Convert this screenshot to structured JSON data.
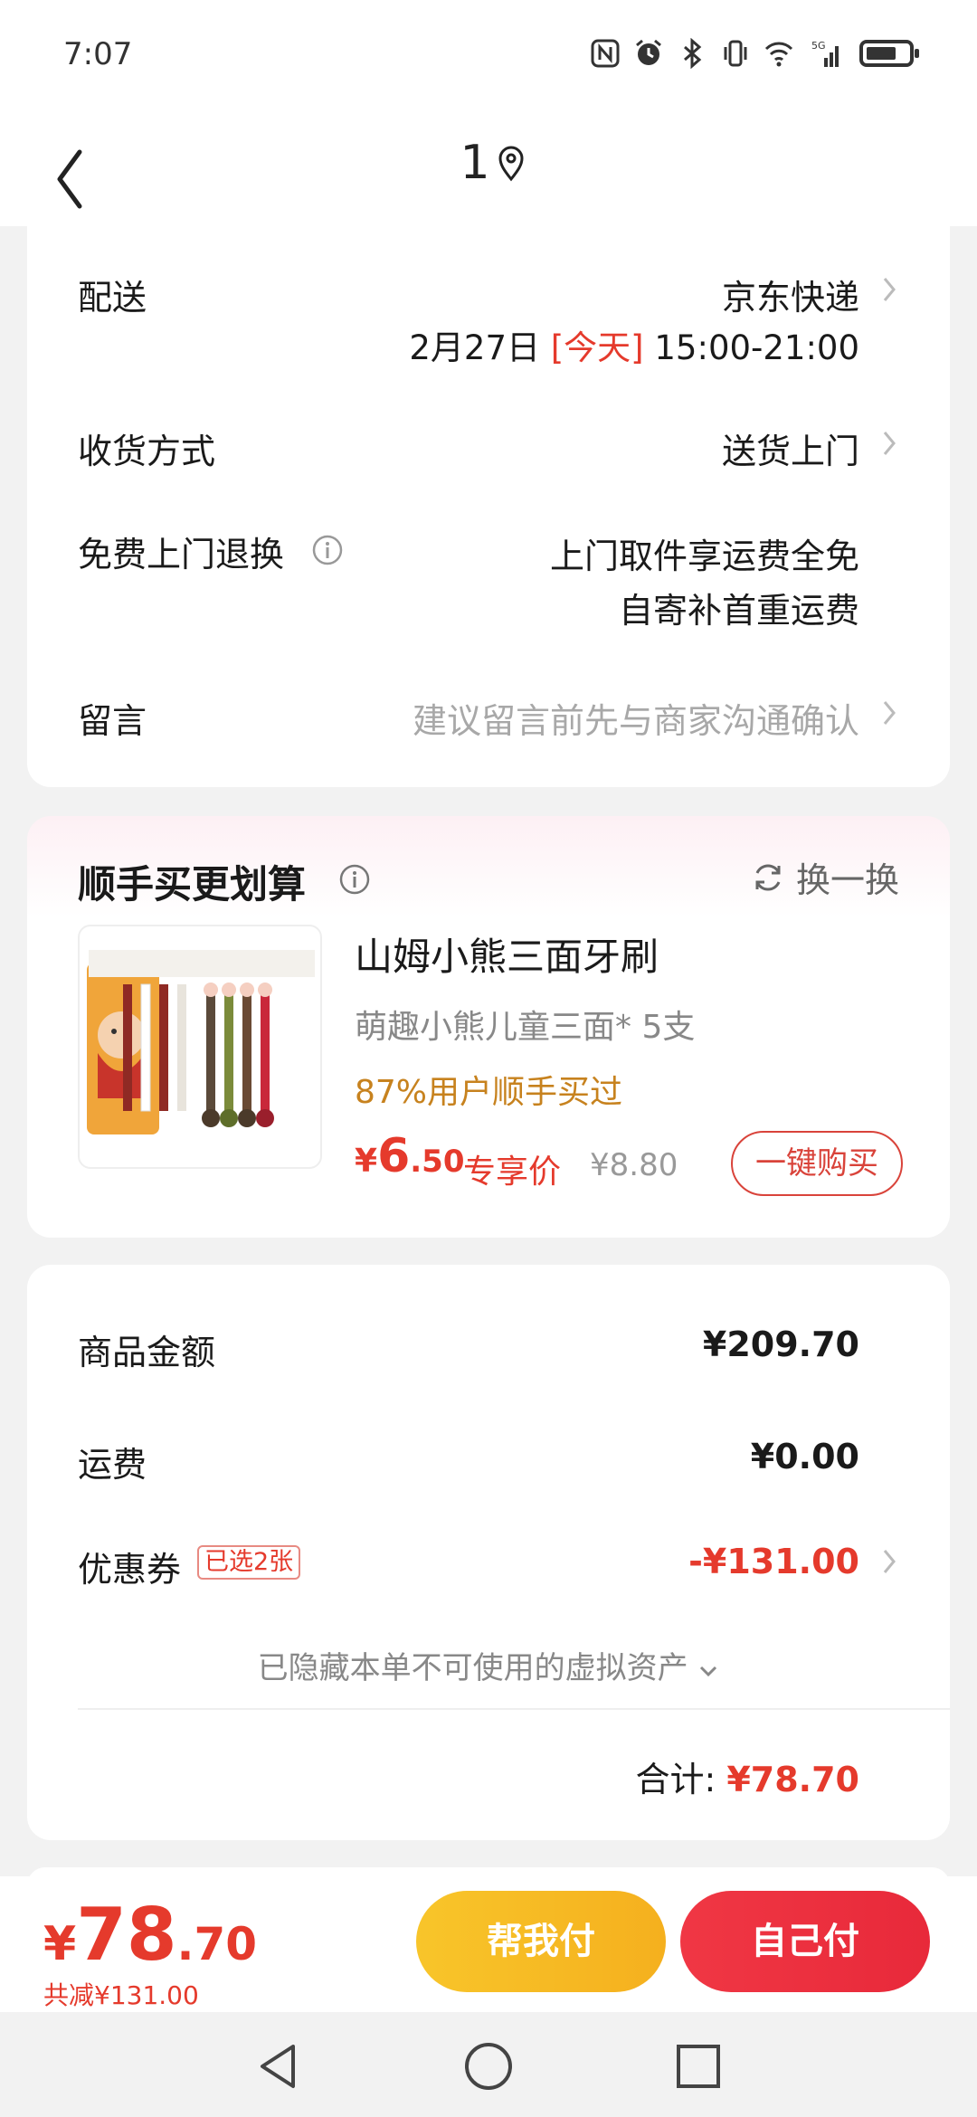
{
  "status_bar": {
    "time": "7:07",
    "icons": [
      "nfc-icon",
      "alarm-icon",
      "bluetooth-icon",
      "vibrate-icon",
      "wifi-icon",
      "signal-5g-icon",
      "battery-icon"
    ]
  },
  "header": {
    "title": "1",
    "back_icon": "chevron-left-icon",
    "location_icon": "location-pin-icon"
  },
  "delivery": {
    "label": "配送",
    "carrier": "京东快递",
    "date": "2月27日",
    "today_tag": "[今天]",
    "time_window": "15:00-21:00"
  },
  "receive_method": {
    "label": "收货方式",
    "value": "送货上门"
  },
  "free_return": {
    "label": "免费上门退换",
    "line1": "上门取件享运费全免",
    "line2": "自寄补首重运费"
  },
  "message": {
    "label": "留言",
    "placeholder": "建议留言前先与商家沟通确认"
  },
  "recommendation": {
    "title": "顺手买更划算",
    "swap_label": "换一换",
    "product": {
      "name": "山姆小熊三面牙刷",
      "desc": "萌趣小熊儿童三面* 5支",
      "social": "87%用户顺手买过",
      "price_currency": "¥",
      "price_int": "6",
      "price_dec": ".50",
      "price_tag": "专享价",
      "original_price": "¥8.80",
      "buy_label": "一键购买"
    }
  },
  "summary": {
    "goods_label": "商品金额",
    "goods_value": "¥209.70",
    "shipping_label": "运费",
    "shipping_value": "¥0.00",
    "coupon_label": "优惠券",
    "coupon_badge": "已选2张",
    "coupon_value": "-¥131.00",
    "hidden_note": "已隐藏本单不可使用的虚拟资产",
    "total_label": "合计:",
    "total_value": "¥78.70"
  },
  "bottom_bar": {
    "currency": "¥",
    "total_int": "78",
    "total_dec": ".70",
    "saved": "共减¥131.00",
    "help_pay": "帮我付",
    "self_pay": "自己付"
  },
  "colors": {
    "accent_red": "#e53a2c",
    "yellow": "#f8c52a",
    "social_orange": "#c7821e"
  }
}
